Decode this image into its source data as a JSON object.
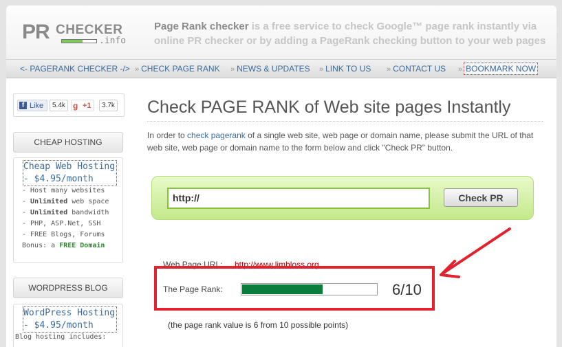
{
  "logo": {
    "pr": "PR",
    "checker": "CHECKER",
    "info": ".info"
  },
  "tagline": {
    "highlight": "Page Rank checker",
    "rest": " is a free service to check Google™ page rank instantly via online PR checker or by adding a PageRank checking button to your web pages"
  },
  "nav": {
    "items": [
      {
        "label": "<- PAGERANK CHECKER -/>"
      },
      {
        "label": "CHECK PAGE RANK"
      },
      {
        "label": "NEWS & UPDATES"
      },
      {
        "label": "LINK TO US"
      },
      {
        "label": "CONTACT US"
      },
      {
        "label": "BOOKMARK NOW"
      }
    ]
  },
  "social": {
    "fb_label": "Like",
    "fb_count": "5.4k",
    "gplus_label": "+1",
    "gplus_count": "3.7k"
  },
  "sidebar": {
    "hosting": {
      "title": "CHEAP HOSTING",
      "promo_line1": "Cheap Web Hosting",
      "promo_line2": "- $4.95/month",
      "features": [
        {
          "prefix": "- ",
          "strong": "",
          "text": "Host many websites"
        },
        {
          "prefix": "- ",
          "strong": "Unlimited",
          "text": " web space"
        },
        {
          "prefix": "- ",
          "strong": "Unlimited",
          "text": " bandwidth"
        },
        {
          "prefix": "- ",
          "strong": "",
          "text": "PHP, ASP.Net, SSH"
        },
        {
          "prefix": "- ",
          "strong": "",
          "text": "FREE Blogs, Forums"
        }
      ],
      "bonus_prefix": "Bonus: a ",
      "bonus_strong": "FREE Domain"
    },
    "wordpress": {
      "title": "WORDPRESS BLOG",
      "promo_line1": "WordPress Hosting",
      "promo_line2": "- $4.95/month",
      "note": "Blog hosting includes:"
    }
  },
  "main": {
    "title": "Check PAGE RANK of Web site pages Instantly",
    "intro_before": "In order to ",
    "intro_link": "check pagerank",
    "intro_after": " of a single web site, web page or domain name, please submit the URL of that web site, web page or domain name to the form below and click \"Check PR\" button.",
    "url_value": "http://",
    "button_label": "Check PR"
  },
  "result": {
    "url_label": "Web Page URL:",
    "url_value": "http://www.limbloss.org",
    "rank_label": "The Page Rank:",
    "rank_value": "6/10",
    "rank_fraction": 0.6,
    "note": "(the page rank value is 6 from 10 possible points)"
  },
  "colors": {
    "accent_link": "#3a6a9e",
    "rank_fill": "#0b7d3b",
    "highlight": "#e0232f"
  },
  "icons": {
    "facebook": "facebook-icon",
    "gplus": "google-plus-icon",
    "nav_separator": "double-chevron-icon",
    "annotation_arrow": "arrow-icon"
  }
}
